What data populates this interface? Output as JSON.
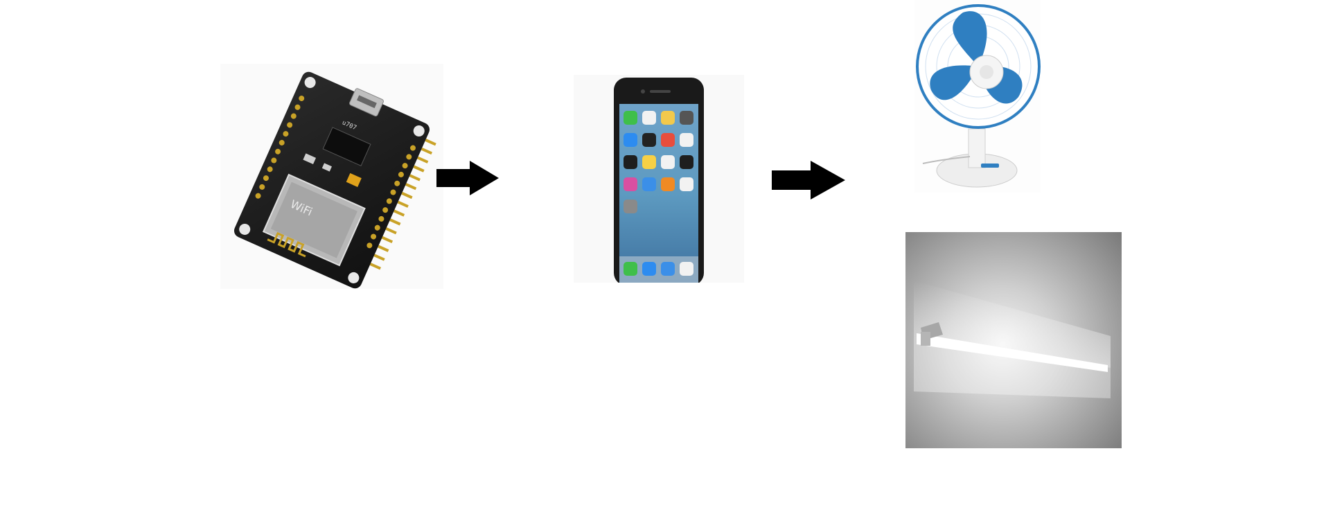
{
  "colors": {
    "background": "#ffffff",
    "arrow": "#000000",
    "pcb": "#1a1a1a",
    "pin": "#c9a227",
    "fan_blue": "#2f7fc1",
    "lamp_glow": "#ffffff"
  },
  "nodes": [
    {
      "id": "mcu",
      "icon": "nodemcu-board-icon",
      "labels": {
        "chip": "u707",
        "wifi": "WiFi"
      }
    },
    {
      "id": "phone",
      "icon": "smartphone-icon"
    },
    {
      "id": "fan",
      "icon": "table-fan-icon"
    },
    {
      "id": "lamp",
      "icon": "led-tube-light-icon"
    }
  ],
  "edges": [
    {
      "from": "mcu",
      "to": "phone"
    },
    {
      "from": "phone",
      "to": "fan"
    },
    {
      "from": "phone",
      "to": "lamp"
    }
  ]
}
